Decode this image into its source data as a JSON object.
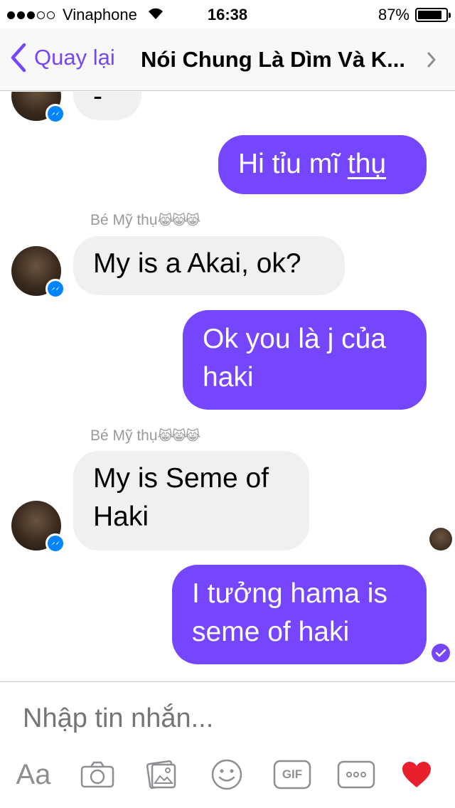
{
  "status_bar": {
    "carrier": "Vinaphone",
    "time": "16:38",
    "battery": "87%",
    "battery_level": 0.87,
    "signal_bars": 3,
    "signal_total": 5
  },
  "nav": {
    "back_label": "Quay lại",
    "title": "Nói Chung Là Dìm Và K..."
  },
  "thread": {
    "sender_name": "Bé Mỹ thụ",
    "sender_emoji": "😹😹😹",
    "messages": [
      {
        "from": "them",
        "text": "-"
      },
      {
        "from": "me",
        "text_plain": "Hi tỉu mĩ ",
        "text_underlined": "thụ"
      },
      {
        "from": "them",
        "text": "My is a Akai, ok?"
      },
      {
        "from": "me",
        "line1": "Ok you là j của",
        "line2": "haki"
      },
      {
        "from": "them",
        "line1": "My is Seme of",
        "line2": "Haki"
      },
      {
        "from": "me",
        "line1": "I tưởng hama is",
        "line2": "seme of haki"
      }
    ]
  },
  "composer": {
    "placeholder": "Nhập tin nhắn...",
    "aa_label": "Aa",
    "gif_label": "GIF",
    "tools": [
      "text-format-icon",
      "camera-icon",
      "photo-icon",
      "emoji-icon",
      "gif-icon",
      "more-icon",
      "heart-icon"
    ]
  },
  "colors": {
    "accent": "#7646ff",
    "incoming_bubble": "#f1f0f0",
    "messenger_badge": "#0084ff",
    "heart": "#e8202d"
  }
}
